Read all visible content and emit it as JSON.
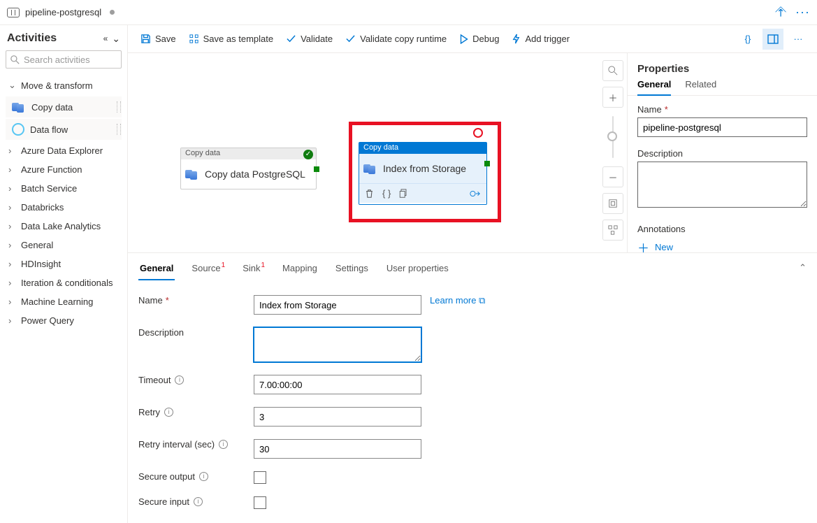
{
  "titlebar": {
    "name": "pipeline-postgresql"
  },
  "activities": {
    "title": "Activities",
    "search_placeholder": "Search activities",
    "expanded_category": "Move & transform",
    "items": [
      "Copy data",
      "Data flow"
    ],
    "categories": [
      "Azure Data Explorer",
      "Azure Function",
      "Batch Service",
      "Databricks",
      "Data Lake Analytics",
      "General",
      "HDInsight",
      "Iteration & conditionals",
      "Machine Learning",
      "Power Query"
    ]
  },
  "toolbar": {
    "save": "Save",
    "template": "Save as template",
    "validate": "Validate",
    "validate_copy": "Validate copy runtime",
    "debug": "Debug",
    "trigger": "Add trigger"
  },
  "canvas": {
    "node1": {
      "type": "Copy data",
      "label": "Copy data PostgreSQL"
    },
    "node2": {
      "type": "Copy data",
      "label": "Index from Storage"
    }
  },
  "tabs": {
    "general": "General",
    "source": "Source",
    "sink": "Sink",
    "mapping": "Mapping",
    "settings": "Settings",
    "userprops": "User properties"
  },
  "form": {
    "name_label": "Name",
    "name_value": "Index from Storage",
    "learn_more": "Learn more",
    "desc_label": "Description",
    "desc_value": "",
    "timeout_label": "Timeout",
    "timeout_value": "7.00:00:00",
    "retry_label": "Retry",
    "retry_value": "3",
    "retry_int_label": "Retry interval (sec)",
    "retry_int_value": "30",
    "secure_out": "Secure output",
    "secure_in": "Secure input"
  },
  "props": {
    "title": "Properties",
    "tab_general": "General",
    "tab_related": "Related",
    "name_label": "Name",
    "name_value": "pipeline-postgresql",
    "desc_label": "Description",
    "desc_value": "",
    "ann_label": "Annotations",
    "new": "New"
  }
}
